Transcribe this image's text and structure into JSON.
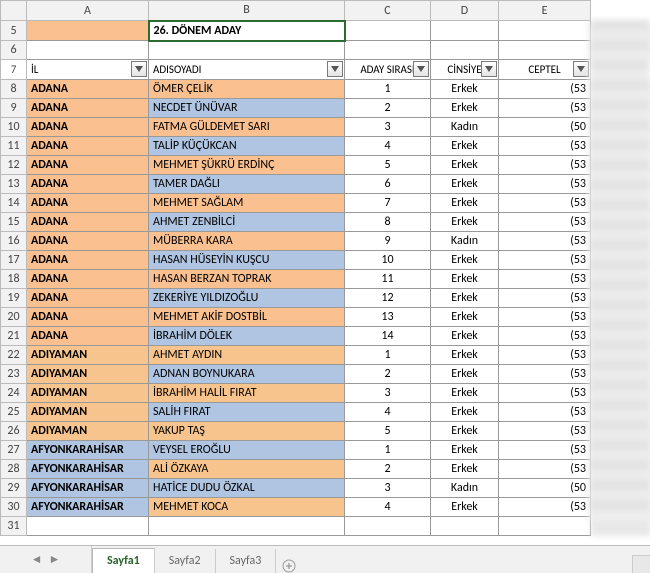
{
  "columns": [
    "A",
    "B",
    "C",
    "D",
    "E"
  ],
  "title": "26. DÖNEM ADAY",
  "headers": {
    "il": "İL",
    "adisoyadi": "ADISOYADI",
    "aday_sirasi": "ADAY SIRASI",
    "cinsiye": "CİNSİYE",
    "ceptel": "CEPTEL"
  },
  "first_row": 5,
  "rows": [
    {
      "n": 8,
      "il": "ADANA",
      "name": "ÖMER ÇELİK",
      "sira": "1",
      "cins": "Erkek",
      "tel": "(53",
      "c1": "orange-a",
      "c2": "orange-a"
    },
    {
      "n": 9,
      "il": "ADANA",
      "name": "NECDET ÜNÜVAR",
      "sira": "2",
      "cins": "Erkek",
      "tel": "(53",
      "c1": "orange-a",
      "c2": "blue-a"
    },
    {
      "n": 10,
      "il": "ADANA",
      "name": "FATMA GÜLDEMET SARI",
      "sira": "3",
      "cins": "Kadın",
      "tel": "(50",
      "c1": "orange-a",
      "c2": "orange-a"
    },
    {
      "n": 11,
      "il": "ADANA",
      "name": "TALİP KÜÇÜKCAN",
      "sira": "4",
      "cins": "Erkek",
      "tel": "(53",
      "c1": "orange-a",
      "c2": "blue-a"
    },
    {
      "n": 12,
      "il": "ADANA",
      "name": "MEHMET ŞÜKRÜ ERDİNÇ",
      "sira": "5",
      "cins": "Erkek",
      "tel": "(53",
      "c1": "orange-a",
      "c2": "orange-a"
    },
    {
      "n": 13,
      "il": "ADANA",
      "name": "TAMER DAĞLI",
      "sira": "6",
      "cins": "Erkek",
      "tel": "(53",
      "c1": "orange-a",
      "c2": "blue-a"
    },
    {
      "n": 14,
      "il": "ADANA",
      "name": "MEHMET SAĞLAM",
      "sira": "7",
      "cins": "Erkek",
      "tel": "(53",
      "c1": "orange-a",
      "c2": "orange-a"
    },
    {
      "n": 15,
      "il": "ADANA",
      "name": "AHMET ZENBİLCİ",
      "sira": "8",
      "cins": "Erkek",
      "tel": "(53",
      "c1": "orange-a",
      "c2": "blue-a"
    },
    {
      "n": 16,
      "il": "ADANA",
      "name": "MÜBERRA KARA",
      "sira": "9",
      "cins": "Kadın",
      "tel": "(53",
      "c1": "orange-a",
      "c2": "orange-a"
    },
    {
      "n": 17,
      "il": "ADANA",
      "name": "HASAN HÜSEYİN KUŞCU",
      "sira": "10",
      "cins": "Erkek",
      "tel": "(53",
      "c1": "orange-a",
      "c2": "blue-a"
    },
    {
      "n": 18,
      "il": "ADANA",
      "name": "HASAN BERZAN TOPRAK",
      "sira": "11",
      "cins": "Erkek",
      "tel": "(53",
      "c1": "orange-a",
      "c2": "orange-a"
    },
    {
      "n": 19,
      "il": "ADANA",
      "name": "ZEKERİYE YILDIZOĞLU",
      "sira": "12",
      "cins": "Erkek",
      "tel": "(53",
      "c1": "orange-a",
      "c2": "blue-a"
    },
    {
      "n": 20,
      "il": "ADANA",
      "name": "MEHMET AKİF DOSTBİL",
      "sira": "13",
      "cins": "Erkek",
      "tel": "(53",
      "c1": "orange-a",
      "c2": "orange-a"
    },
    {
      "n": 21,
      "il": "ADANA",
      "name": "İBRAHİM DÖLEK",
      "sira": "14",
      "cins": "Erkek",
      "tel": "(53",
      "c1": "orange-a",
      "c2": "blue-a"
    },
    {
      "n": 22,
      "il": "ADIYAMAN",
      "name": "AHMET AYDIN",
      "sira": "1",
      "cins": "Erkek",
      "tel": "(53",
      "c1": "orange-b",
      "c2": "orange-b"
    },
    {
      "n": 23,
      "il": "ADIYAMAN",
      "name": "ADNAN BOYNUKARA",
      "sira": "2",
      "cins": "Erkek",
      "tel": "(53",
      "c1": "orange-b",
      "c2": "blue-a"
    },
    {
      "n": 24,
      "il": "ADIYAMAN",
      "name": "İBRAHİM HALİL FIRAT",
      "sira": "3",
      "cins": "Erkek",
      "tel": "(53",
      "c1": "orange-b",
      "c2": "orange-b"
    },
    {
      "n": 25,
      "il": "ADIYAMAN",
      "name": "SALİH FIRAT",
      "sira": "4",
      "cins": "Erkek",
      "tel": "(53",
      "c1": "orange-b",
      "c2": "blue-a"
    },
    {
      "n": 26,
      "il": "ADIYAMAN",
      "name": "YAKUP TAŞ",
      "sira": "5",
      "cins": "Erkek",
      "tel": "(53",
      "c1": "orange-b",
      "c2": "orange-b"
    },
    {
      "n": 27,
      "il": "AFYONKARAHİSAR",
      "name": "VEYSEL EROĞLU",
      "sira": "1",
      "cins": "Erkek",
      "tel": "(53",
      "c1": "blue-a",
      "c2": "blue-a"
    },
    {
      "n": 28,
      "il": "AFYONKARAHİSAR",
      "name": "ALİ ÖZKAYA",
      "sira": "2",
      "cins": "Erkek",
      "tel": "(53",
      "c1": "blue-a",
      "c2": "orange-b"
    },
    {
      "n": 29,
      "il": "AFYONKARAHİSAR",
      "name": "HATİCE DUDU ÖZKAL",
      "sira": "3",
      "cins": "Kadın",
      "tel": "(50",
      "c1": "blue-a",
      "c2": "blue-a"
    },
    {
      "n": 30,
      "il": "AFYONKARAHİSAR",
      "name": "MEHMET KOCA",
      "sira": "4",
      "cins": "Erkek",
      "tel": "(53",
      "c1": "blue-a",
      "c2": "orange-b"
    }
  ],
  "tabs": [
    "Sayfa1",
    "Sayfa2",
    "Sayfa3"
  ],
  "active_tab": 0
}
